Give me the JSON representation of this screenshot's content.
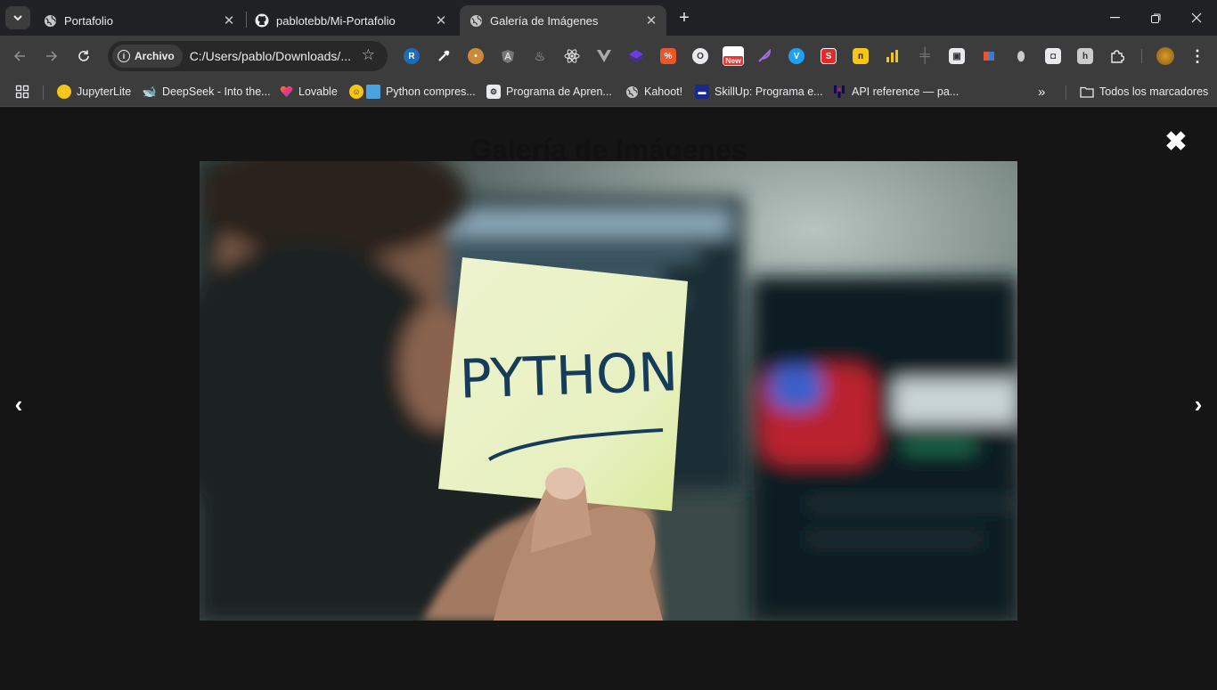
{
  "browser": {
    "tabs": [
      {
        "title": "Portafolio",
        "icon": "globe-icon",
        "active": false
      },
      {
        "title": "pablotebb/Mi-Portafolio",
        "icon": "github-icon",
        "active": false
      },
      {
        "title": "Galería de Imágenes",
        "icon": "globe-icon",
        "active": true
      }
    ],
    "address": {
      "chip_label": "Archivo",
      "url": "C:/Users/pablo/Downloads/..."
    },
    "extension_badge": "New",
    "bookmarks": [
      {
        "label": "JupyterLite",
        "icon": "jupyter-icon"
      },
      {
        "label": "DeepSeek - Into the...",
        "icon": "deepseek-icon"
      },
      {
        "label": "Lovable",
        "icon": "heart-icon"
      },
      {
        "label": "Python compres...",
        "icon": "python-emoji-icon"
      },
      {
        "label": "Programa de Apren...",
        "icon": "program-icon"
      },
      {
        "label": "Kahoot!",
        "icon": "globe-icon"
      },
      {
        "label": "SkillUp: Programa e...",
        "icon": "skillup-icon"
      },
      {
        "label": "API reference — pa...",
        "icon": "pandas-icon"
      }
    ],
    "all_bookmarks_label": "Todos los marcadores"
  },
  "page": {
    "title": "Galería de Imágenes",
    "lightbox": {
      "close_glyph": "✖",
      "prev_glyph": "‹",
      "next_glyph": "›",
      "image_text": "PYTHON"
    }
  }
}
